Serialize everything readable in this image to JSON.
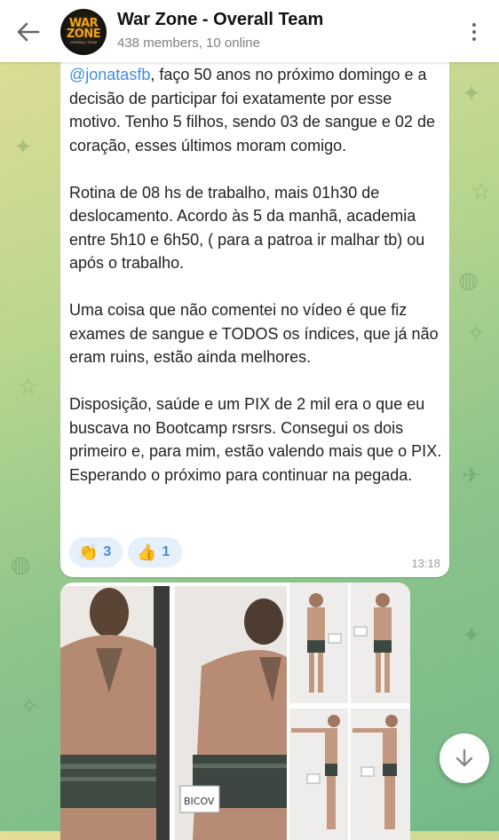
{
  "header": {
    "title": "War Zone - Overall Team",
    "subtitle": "438 members, 10 online",
    "avatar_line1": "WAR",
    "avatar_line2": "ZONE",
    "avatar_line3": "OVERALL TEAM"
  },
  "message": {
    "mention": "@jonatasfb",
    "body": ", faço 50 anos no próximo domingo e a decisão de participar foi exatamente por esse motivo. Tenho 5 filhos, sendo 03 de sangue e 02 de coração, esses últimos moram comigo.\n\nRotina de 08 hs de trabalho, mais 01h30 de deslocamento. Acordo às 5 da manhã, academia entre 5h10 e 6h50, ( para a patroa ir malhar tb) ou após o trabalho.\n\nUma coisa que não comentei no vídeo é que fiz exames de sangue e TODOS os índices, que já não eram ruins, estão ainda melhores.\n\nDisposição, saúde e um PIX de 2 mil era o que eu buscava no Bootcamp rsrsrs. Consegui os dois primeiro e, para mim, estão valendo mais que o PIX. Esperando o próximo para continuar na pegada.",
    "time": "13:18",
    "reactions": [
      {
        "emoji": "👏",
        "count": "3"
      },
      {
        "emoji": "👍",
        "count": "1"
      }
    ]
  },
  "album": {
    "photo_labels": [
      "BICOV",
      "BICOV",
      "BICOV",
      "BICOV",
      "BICOV"
    ]
  },
  "colors": {
    "accent": "#3d8ee0",
    "reaction_bg": "#e6f0fa",
    "header_bg": "#ffffff"
  }
}
